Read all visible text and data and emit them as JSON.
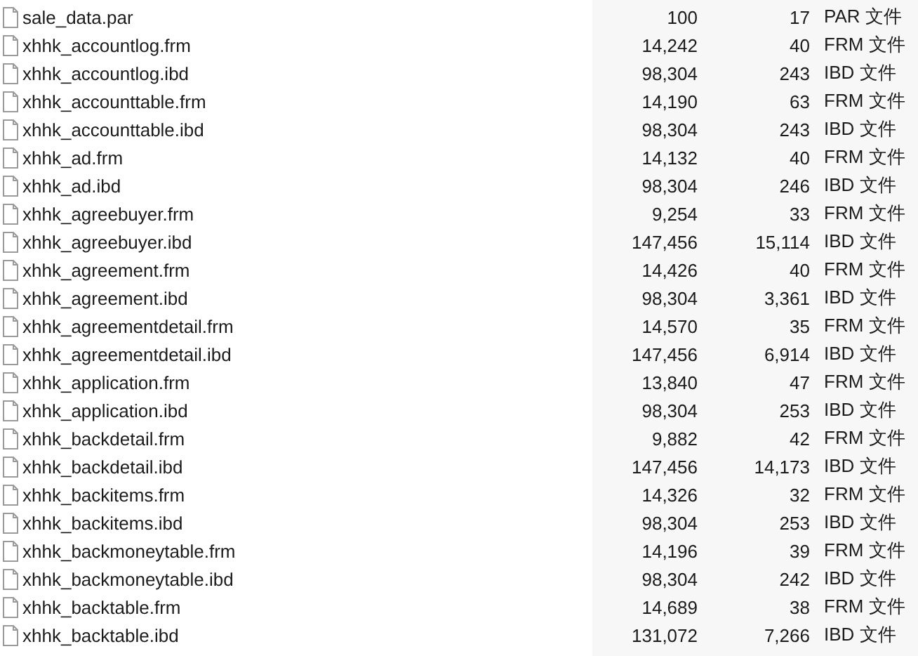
{
  "files": [
    {
      "name": "sale_data.par",
      "column_2": "100",
      "column_3": "17",
      "type": "PAR 文件"
    },
    {
      "name": "xhhk_accountlog.frm",
      "column_2": "14,242",
      "column_3": "40",
      "type": "FRM 文件"
    },
    {
      "name": "xhhk_accountlog.ibd",
      "column_2": "98,304",
      "column_3": "243",
      "type": "IBD 文件"
    },
    {
      "name": "xhhk_accounttable.frm",
      "column_2": "14,190",
      "column_3": "63",
      "type": "FRM 文件"
    },
    {
      "name": "xhhk_accounttable.ibd",
      "column_2": "98,304",
      "column_3": "243",
      "type": "IBD 文件"
    },
    {
      "name": "xhhk_ad.frm",
      "column_2": "14,132",
      "column_3": "40",
      "type": "FRM 文件"
    },
    {
      "name": "xhhk_ad.ibd",
      "column_2": "98,304",
      "column_3": "246",
      "type": "IBD 文件"
    },
    {
      "name": "xhhk_agreebuyer.frm",
      "column_2": "9,254",
      "column_3": "33",
      "type": "FRM 文件"
    },
    {
      "name": "xhhk_agreebuyer.ibd",
      "column_2": "147,456",
      "column_3": "15,114",
      "type": "IBD 文件"
    },
    {
      "name": "xhhk_agreement.frm",
      "column_2": "14,426",
      "column_3": "40",
      "type": "FRM 文件"
    },
    {
      "name": "xhhk_agreement.ibd",
      "column_2": "98,304",
      "column_3": "3,361",
      "type": "IBD 文件"
    },
    {
      "name": "xhhk_agreementdetail.frm",
      "column_2": "14,570",
      "column_3": "35",
      "type": "FRM 文件"
    },
    {
      "name": "xhhk_agreementdetail.ibd",
      "column_2": "147,456",
      "column_3": "6,914",
      "type": "IBD 文件"
    },
    {
      "name": "xhhk_application.frm",
      "column_2": "13,840",
      "column_3": "47",
      "type": "FRM 文件"
    },
    {
      "name": "xhhk_application.ibd",
      "column_2": "98,304",
      "column_3": "253",
      "type": "IBD 文件"
    },
    {
      "name": "xhhk_backdetail.frm",
      "column_2": "9,882",
      "column_3": "42",
      "type": "FRM 文件"
    },
    {
      "name": "xhhk_backdetail.ibd",
      "column_2": "147,456",
      "column_3": "14,173",
      "type": "IBD 文件"
    },
    {
      "name": "xhhk_backitems.frm",
      "column_2": "14,326",
      "column_3": "32",
      "type": "FRM 文件"
    },
    {
      "name": "xhhk_backitems.ibd",
      "column_2": "98,304",
      "column_3": "253",
      "type": "IBD 文件"
    },
    {
      "name": "xhhk_backmoneytable.frm",
      "column_2": "14,196",
      "column_3": "39",
      "type": "FRM 文件"
    },
    {
      "name": "xhhk_backmoneytable.ibd",
      "column_2": "98,304",
      "column_3": "242",
      "type": "IBD 文件"
    },
    {
      "name": "xhhk_backtable.frm",
      "column_2": "14,689",
      "column_3": "38",
      "type": "FRM 文件"
    },
    {
      "name": "xhhk_backtable.ibd",
      "column_2": "131,072",
      "column_3": "7,266",
      "type": "IBD 文件"
    }
  ]
}
